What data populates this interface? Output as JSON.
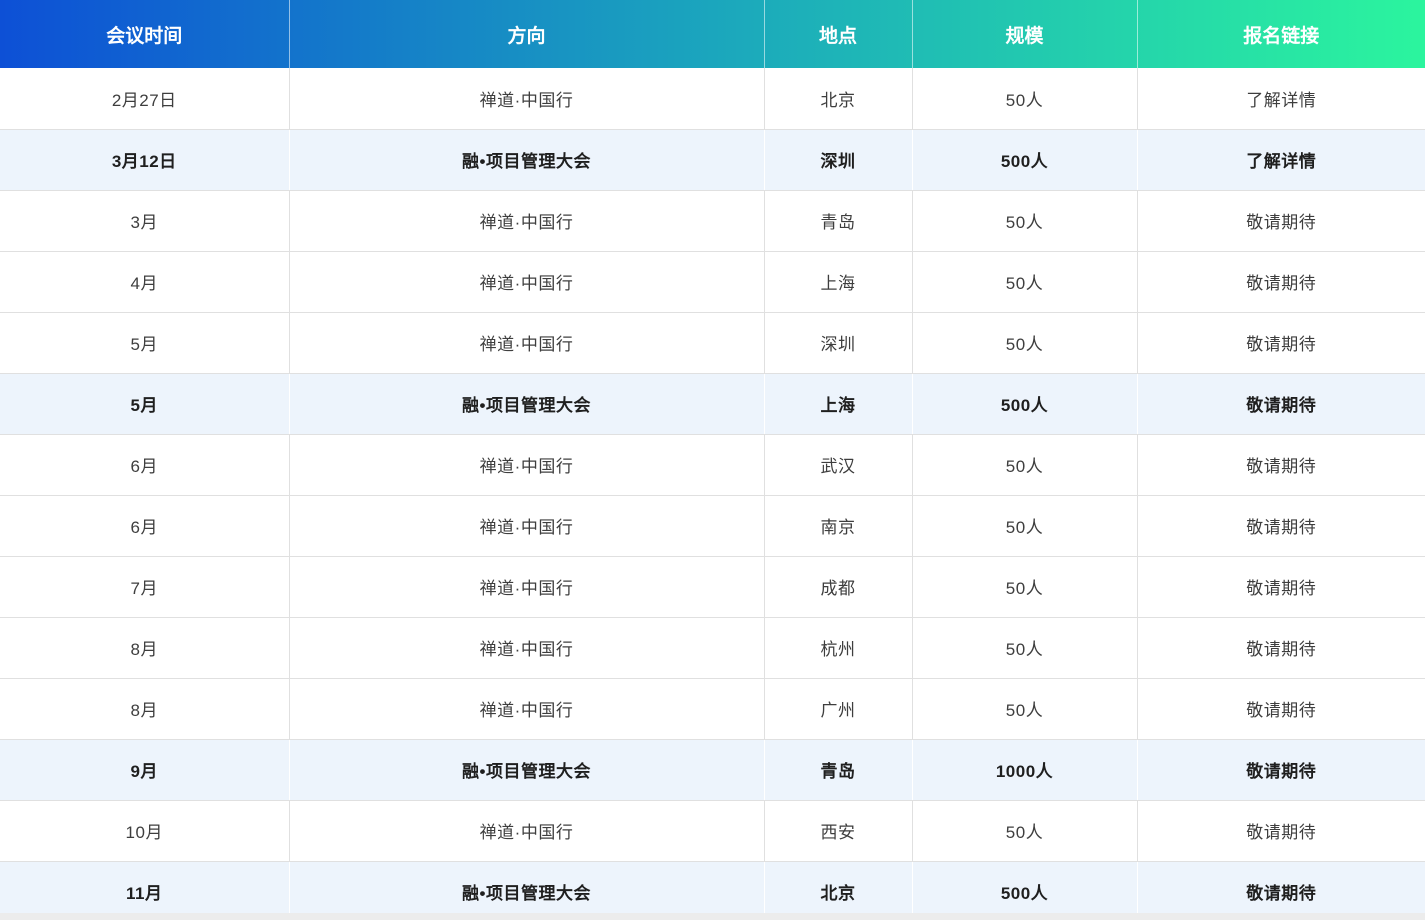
{
  "table": {
    "columns": [
      {
        "key": "time",
        "label": "会议时间"
      },
      {
        "key": "direction",
        "label": "方向"
      },
      {
        "key": "location",
        "label": "地点"
      },
      {
        "key": "scale",
        "label": "规模"
      },
      {
        "key": "link",
        "label": "报名链接"
      }
    ],
    "rows": [
      {
        "time": "2月27日",
        "direction": "禅道·中国行",
        "location": "北京",
        "scale": "50人",
        "link": "了解详情",
        "highlight": false,
        "link_clickable": true
      },
      {
        "time": "3月12日",
        "direction": "融•项目管理大会",
        "location": "深圳",
        "scale": "500人",
        "link": "了解详情",
        "highlight": true,
        "link_clickable": true
      },
      {
        "time": "3月",
        "direction": "禅道·中国行",
        "location": "青岛",
        "scale": "50人",
        "link": "敬请期待",
        "highlight": false,
        "link_clickable": false
      },
      {
        "time": "4月",
        "direction": "禅道·中国行",
        "location": "上海",
        "scale": "50人",
        "link": "敬请期待",
        "highlight": false,
        "link_clickable": false
      },
      {
        "time": "5月",
        "direction": "禅道·中国行",
        "location": "深圳",
        "scale": "50人",
        "link": "敬请期待",
        "highlight": false,
        "link_clickable": false
      },
      {
        "time": "5月",
        "direction": "融•项目管理大会",
        "location": "上海",
        "scale": "500人",
        "link": "敬请期待",
        "highlight": true,
        "link_clickable": false
      },
      {
        "time": "6月",
        "direction": "禅道·中国行",
        "location": "武汉",
        "scale": "50人",
        "link": "敬请期待",
        "highlight": false,
        "link_clickable": false
      },
      {
        "time": "6月",
        "direction": "禅道·中国行",
        "location": "南京",
        "scale": "50人",
        "link": "敬请期待",
        "highlight": false,
        "link_clickable": false
      },
      {
        "time": "7月",
        "direction": "禅道·中国行",
        "location": "成都",
        "scale": "50人",
        "link": "敬请期待",
        "highlight": false,
        "link_clickable": false
      },
      {
        "time": "8月",
        "direction": "禅道·中国行",
        "location": "杭州",
        "scale": "50人",
        "link": "敬请期待",
        "highlight": false,
        "link_clickable": false
      },
      {
        "time": "8月",
        "direction": "禅道·中国行",
        "location": "广州",
        "scale": "50人",
        "link": "敬请期待",
        "highlight": false,
        "link_clickable": false
      },
      {
        "time": "9月",
        "direction": "融•项目管理大会",
        "location": "青岛",
        "scale": "1000人",
        "link": "敬请期待",
        "highlight": true,
        "link_clickable": false
      },
      {
        "time": "10月",
        "direction": "禅道·中国行",
        "location": "西安",
        "scale": "50人",
        "link": "敬请期待",
        "highlight": false,
        "link_clickable": false
      },
      {
        "time": "11月",
        "direction": "融•项目管理大会",
        "location": "北京",
        "scale": "500人",
        "link": "敬请期待",
        "highlight": true,
        "link_clickable": false
      }
    ]
  },
  "colors": {
    "header_gradient_start": "#0d50d6",
    "header_gradient_mid": "#1ba6bd",
    "header_gradient_end": "#2bf59e",
    "highlight_row_bg": "#edf4fc",
    "body_text": "#3e3e3e",
    "cell_border": "#e0e0e0"
  }
}
